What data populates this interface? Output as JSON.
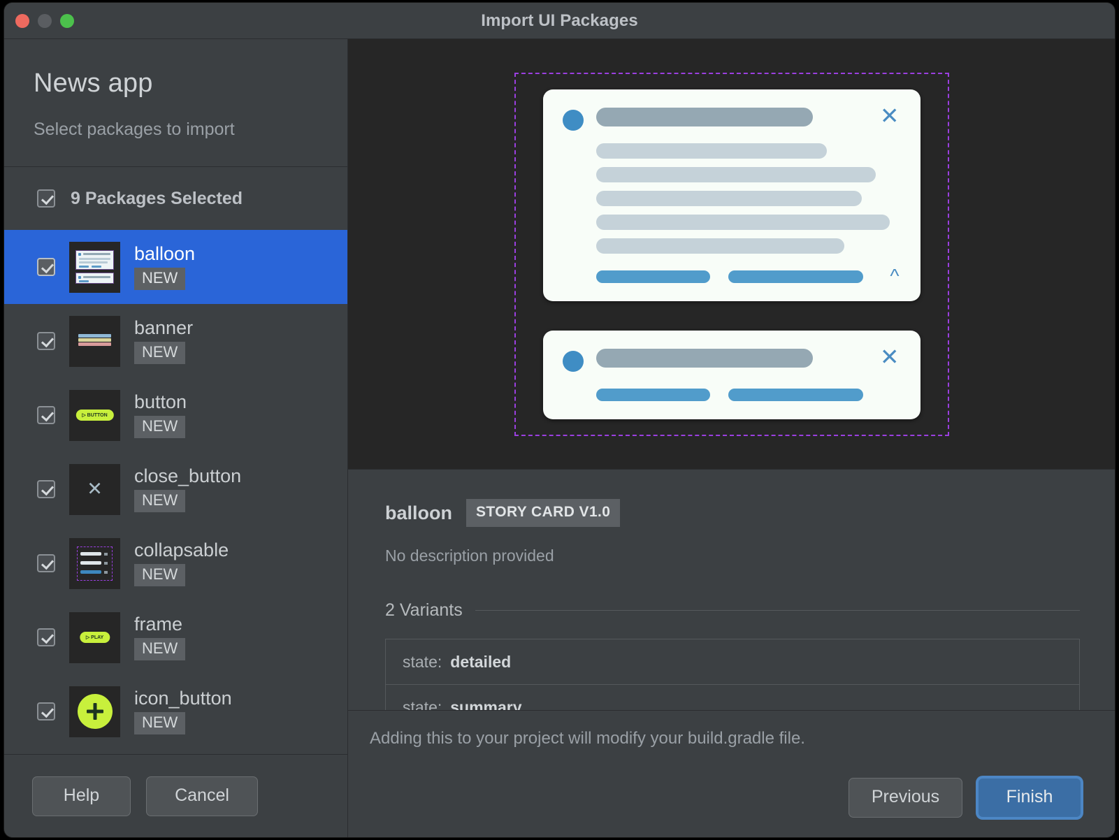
{
  "window": {
    "title": "Import UI Packages",
    "traffic_lights": [
      "close-red",
      "minimize-yellow",
      "zoom-green"
    ]
  },
  "sidebar": {
    "project_title": "News app",
    "subtitle": "Select packages to import",
    "select_all": {
      "label": "9 Packages Selected",
      "checked": true
    },
    "packages": [
      {
        "name": "balloon",
        "badge": "NEW",
        "checked": true,
        "selected": true,
        "thumb": "balloon-thumb-icon"
      },
      {
        "name": "banner",
        "badge": "NEW",
        "checked": true,
        "selected": false,
        "thumb": "banner-thumb-icon"
      },
      {
        "name": "button",
        "badge": "NEW",
        "checked": true,
        "selected": false,
        "thumb": "button-thumb-icon"
      },
      {
        "name": "close_button",
        "badge": "NEW",
        "checked": true,
        "selected": false,
        "thumb": "close-thumb-icon"
      },
      {
        "name": "collapsable",
        "badge": "NEW",
        "checked": true,
        "selected": false,
        "thumb": "collapsable-thumb-icon"
      },
      {
        "name": "frame",
        "badge": "NEW",
        "checked": true,
        "selected": false,
        "thumb": "frame-thumb-icon"
      },
      {
        "name": "icon_button",
        "badge": "NEW",
        "checked": true,
        "selected": false,
        "thumb": "icon-button-thumb-icon"
      }
    ],
    "footer": {
      "help_label": "Help",
      "cancel_label": "Cancel"
    }
  },
  "preview": {
    "bounds_style": "dashed",
    "bounds_color": "#9b3fe0",
    "cards": [
      {
        "variant": "detailed",
        "avatar_color": "#3f8dc4",
        "title_bar_color": "#95a8b3",
        "line_color": "#c5d2d9",
        "cta_color": "#519ccb",
        "close_icon": "close-icon",
        "expand_icon": "chevron-up-icon",
        "body_lines": [
          330,
          400,
          380,
          505,
          400
        ],
        "ctas": [
          165,
          195
        ]
      },
      {
        "variant": "summary",
        "avatar_color": "#3f8dc4",
        "title_bar_color": "#95a8b3",
        "cta_color": "#519ccb",
        "close_icon": "close-icon",
        "body_lines": [],
        "ctas": [
          165,
          195
        ]
      }
    ]
  },
  "details": {
    "name": "balloon",
    "tag": "STORY CARD V1.0",
    "description": "No description provided",
    "variants_heading": "2 Variants",
    "variants": [
      {
        "key": "state:",
        "value": "detailed"
      },
      {
        "key": "state:",
        "value": "summary"
      }
    ]
  },
  "footer": {
    "note": "Adding this to your project will modify your build.gradle file.",
    "previous_label": "Previous",
    "finish_label": "Finish",
    "finish_color": "#3b6ea5"
  }
}
